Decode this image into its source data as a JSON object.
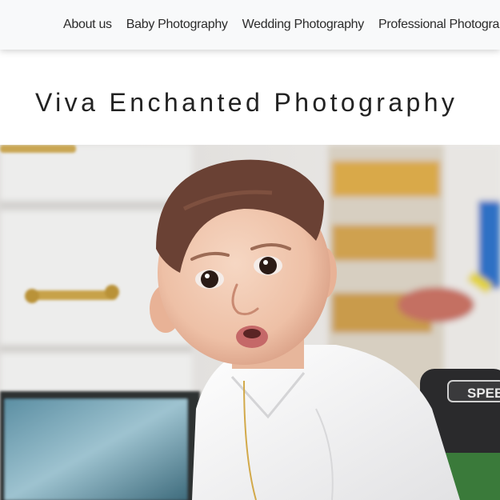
{
  "nav": {
    "items": [
      {
        "label": "About us"
      },
      {
        "label": "Baby Photography"
      },
      {
        "label": "Wedding Photography"
      },
      {
        "label": "Professional Photography"
      }
    ]
  },
  "site": {
    "title": "Viva Enchanted Photography"
  },
  "hero": {
    "alt": "Baby in white shirt",
    "toy_label": "SPEE"
  },
  "colors": {
    "nav_bg": "#f8f9fa",
    "text": "#222222"
  }
}
